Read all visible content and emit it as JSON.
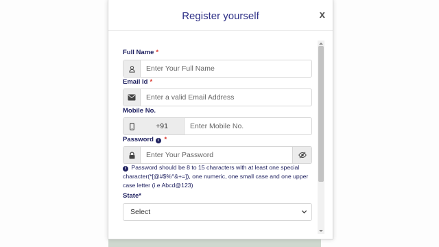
{
  "modal": {
    "title": "Register yourself",
    "close_label": "x"
  },
  "form": {
    "full_name": {
      "label": "Full Name",
      "required": "*",
      "placeholder": "Enter Your Full Name",
      "icon": "user-icon"
    },
    "email": {
      "label": "Email Id",
      "required": "*",
      "placeholder": "Enter a valid Email Address",
      "icon": "envelope-icon"
    },
    "mobile": {
      "label": "Mobile No.",
      "country_code": "+91",
      "placeholder": "Enter Mobile No.",
      "icon": "mobile-phone-icon"
    },
    "password": {
      "label": "Password",
      "required": "*",
      "placeholder": "Enter Your Password",
      "icon": "lock-icon",
      "toggle_icon": "eye-slash-icon",
      "hint": "Password should be 8 to 15 characters with at least one special character(*[@#$%^&+=]), one numeric, one small case and one upper case letter (i.e Abcd@123)"
    },
    "state": {
      "label": "State*",
      "selected": "Select"
    }
  },
  "colors": {
    "title": "#2d2f86",
    "label": "#1f2160",
    "required": "#d9342b",
    "addon_bg": "#ececec"
  }
}
